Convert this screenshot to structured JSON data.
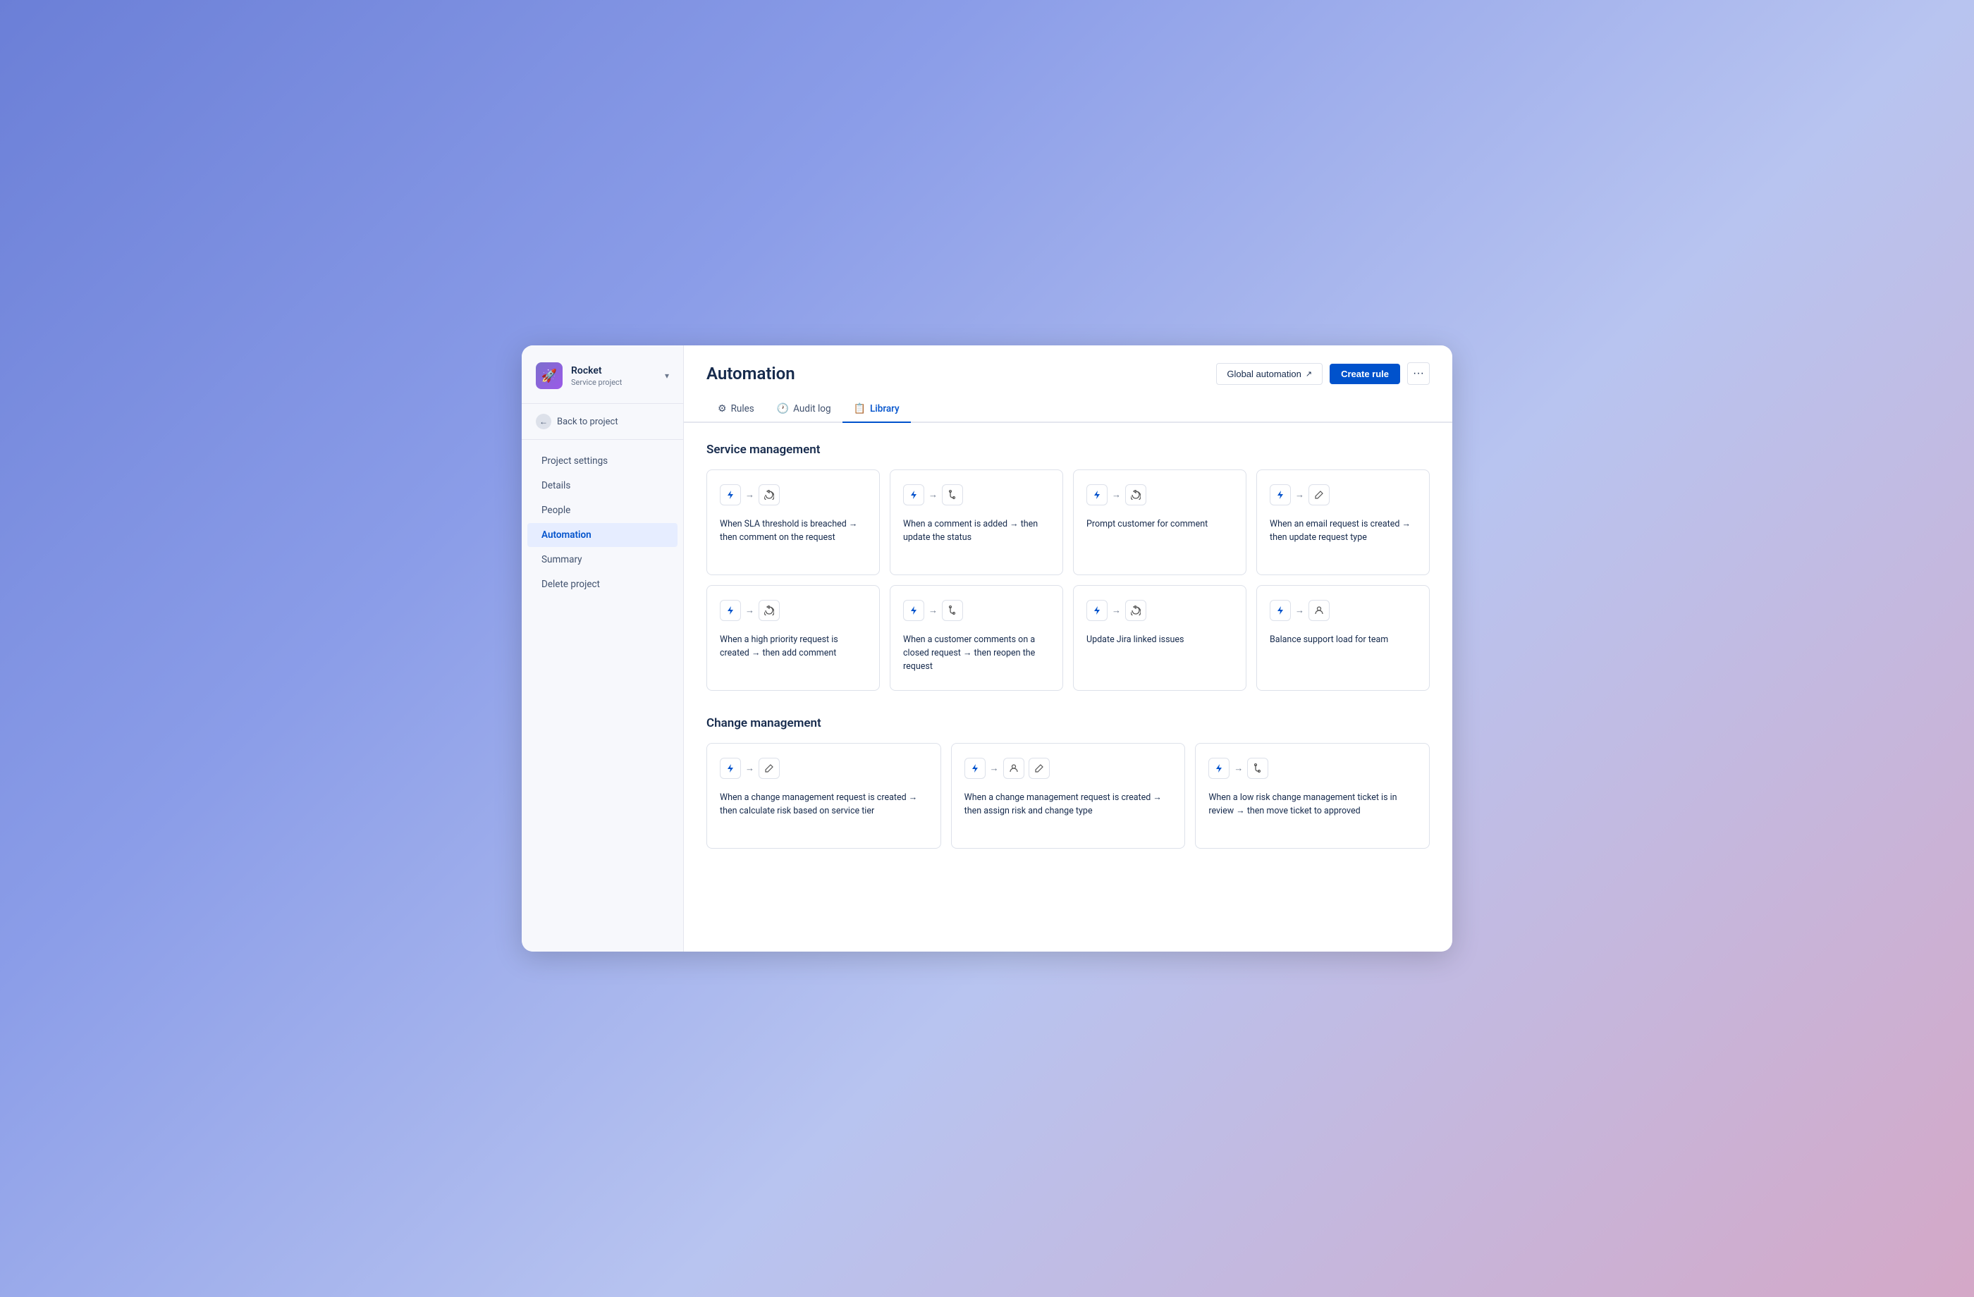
{
  "sidebar": {
    "project": {
      "name": "Rocket",
      "type": "Service project",
      "avatar": "🚀"
    },
    "back_label": "Back to project",
    "nav_items": [
      {
        "id": "project-settings",
        "label": "Project settings",
        "active": false
      },
      {
        "id": "details",
        "label": "Details",
        "active": false
      },
      {
        "id": "people",
        "label": "People",
        "active": false
      },
      {
        "id": "automation",
        "label": "Automation",
        "active": true
      },
      {
        "id": "summary",
        "label": "Summary",
        "active": false
      },
      {
        "id": "delete-project",
        "label": "Delete project",
        "active": false
      }
    ]
  },
  "header": {
    "title": "Automation",
    "global_automation_label": "Global automation",
    "create_rule_label": "Create rule",
    "more_label": "···"
  },
  "tabs": [
    {
      "id": "rules",
      "label": "Rules",
      "icon": "⚙",
      "active": false
    },
    {
      "id": "audit-log",
      "label": "Audit log",
      "icon": "🕐",
      "active": false
    },
    {
      "id": "library",
      "label": "Library",
      "icon": "📋",
      "active": true
    }
  ],
  "sections": [
    {
      "id": "service-management",
      "title": "Service management",
      "grid": 4,
      "cards": [
        {
          "id": "sla-threshold",
          "icons": [
            "lightning",
            "arrow",
            "refresh"
          ],
          "text": "When SLA threshold is breached → then comment on the request"
        },
        {
          "id": "comment-status",
          "icons": [
            "lightning",
            "arrow",
            "branch"
          ],
          "text": "When a comment is added → then update the status"
        },
        {
          "id": "prompt-customer",
          "icons": [
            "lightning",
            "arrow",
            "refresh"
          ],
          "text": "Prompt customer for comment"
        },
        {
          "id": "email-request",
          "icons": [
            "lightning",
            "arrow",
            "edit"
          ],
          "text": "When an email request is created → then update request type"
        },
        {
          "id": "high-priority",
          "icons": [
            "lightning",
            "arrow",
            "refresh"
          ],
          "text": "When a high priority request is created → then add comment"
        },
        {
          "id": "customer-closed",
          "icons": [
            "lightning",
            "arrow",
            "branch"
          ],
          "text": "When a customer comments on a closed request → then reopen the request"
        },
        {
          "id": "update-jira",
          "icons": [
            "lightning",
            "arrow",
            "refresh"
          ],
          "text": "Update Jira linked issues"
        },
        {
          "id": "balance-support",
          "icons": [
            "lightning",
            "arrow",
            "person"
          ],
          "text": "Balance support load for team"
        }
      ]
    },
    {
      "id": "change-management",
      "title": "Change management",
      "grid": 3,
      "cards": [
        {
          "id": "change-risk",
          "icons": [
            "lightning",
            "arrow",
            "edit"
          ],
          "text": "When a change management request is created → then calculate risk based on service tier"
        },
        {
          "id": "change-assign",
          "icons": [
            "lightning",
            "arrow",
            "person",
            "edit"
          ],
          "text": "When a change management request is created → then assign risk and change type"
        },
        {
          "id": "low-risk",
          "icons": [
            "lightning",
            "arrow",
            "branch"
          ],
          "text": "When a low risk change management ticket is in review → then move ticket to approved"
        }
      ]
    }
  ]
}
